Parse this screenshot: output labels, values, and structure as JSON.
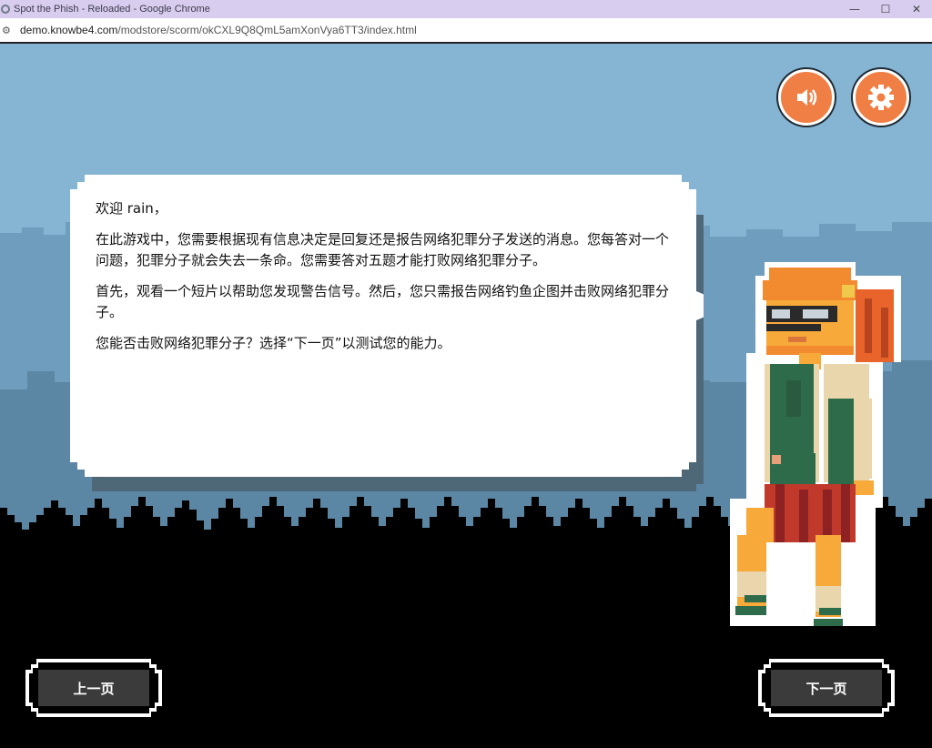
{
  "window": {
    "title": "Spot the Phish - Reloaded - Google Chrome",
    "minimize_glyph": "—",
    "maximize_glyph": "☐",
    "close_glyph": "✕"
  },
  "address_bar": {
    "host": "demo.knowbe4.com",
    "path": "/modstore/scorm/okCXL9Q8QmL5amXonVya6TT3/index.html",
    "site_info_icon": "tune-icon"
  },
  "controls": {
    "sound_icon": "speaker-icon",
    "settings_icon": "gear-icon"
  },
  "dialog": {
    "greeting": "欢迎 rain，",
    "paragraph1": "在此游戏中，您需要根据现有信息决定是回复还是报告网络犯罪分子发送的消息。您每答对一个问题，犯罪分子就会失去一条命。您需要答对五题才能打败网络犯罪分子。",
    "paragraph2": "首先，观看一个短片以帮助您发现警告信号。然后，您只需报告网络钓鱼企图并击败网络犯罪分子。",
    "paragraph3": "您能否击败网络犯罪分子？选择“下一页”以测试您的能力。"
  },
  "nav": {
    "prev_label": "上一页",
    "next_label": "下一页"
  },
  "colors": {
    "sky": "#86b4d3",
    "mountains_back": "#6f9dbd",
    "mountains_front": "#5b86a4",
    "ground": "#000000",
    "accent_orange": "#f07f45",
    "button_fill": "#3b3b3b"
  }
}
